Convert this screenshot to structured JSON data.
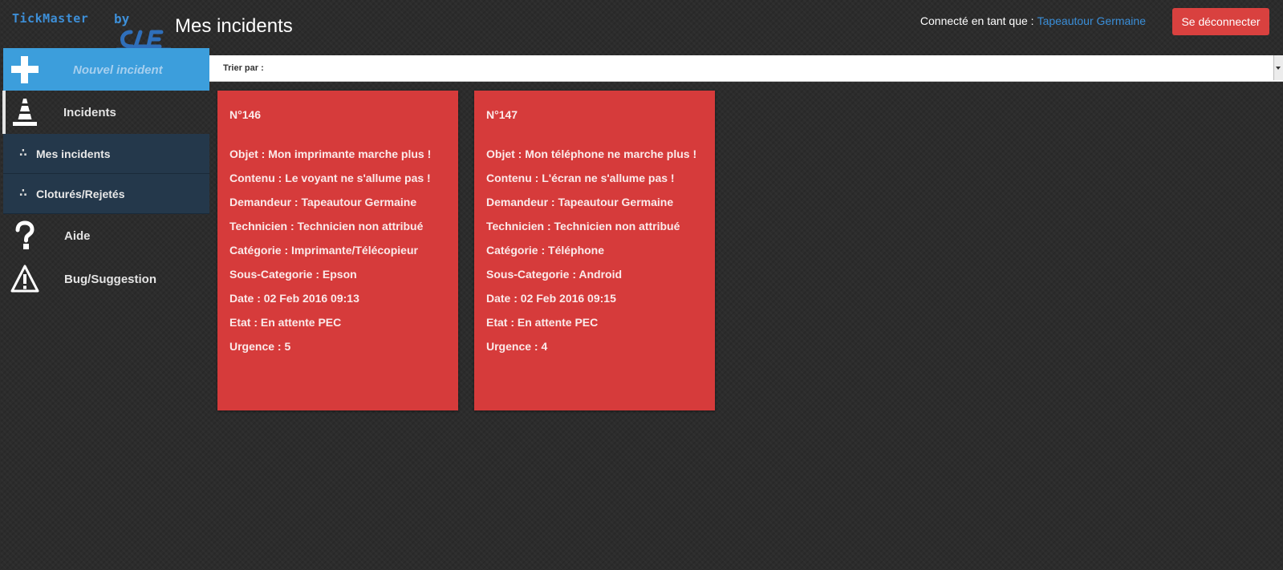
{
  "header": {
    "brand": "TickMaster",
    "by": "by",
    "page_title": "Mes incidents",
    "connected_label": "Connecté en tant que :",
    "user_name": "Tapeautour Germaine",
    "logout_label": "Se déconnecter",
    "accent_color": "#3a8ed8",
    "logout_color": "#d9413f"
  },
  "sidebar": {
    "new_incident": {
      "label": "Nouvel incident",
      "icon": "plus-icon",
      "color": "#3c9edc"
    },
    "incidents": {
      "label": "Incidents",
      "icon": "traffic-cone-icon"
    },
    "submenu": [
      {
        "label": "Mes incidents",
        "icon": "dots-icon"
      },
      {
        "label": "Cloturés/Rejetés",
        "icon": "dots-icon"
      }
    ],
    "help": {
      "label": "Aide",
      "icon": "question-mark-icon"
    },
    "bug": {
      "label": "Bug/Suggestion",
      "icon": "warning-icon"
    }
  },
  "sort": {
    "label": "Trier par :",
    "selected": ""
  },
  "incidents": [
    {
      "number": "N°146",
      "fields": [
        "Objet : Mon imprimante marche plus !",
        "Contenu : Le voyant ne s'allume pas !",
        "Demandeur : Tapeautour Germaine",
        "Technicien : Technicien non attribué",
        "Catégorie : Imprimante/Télécopieur",
        "Sous-Categorie : Epson",
        "Date : 02 Feb 2016 09:13",
        "Etat : En attente PEC",
        "Urgence : 5"
      ]
    },
    {
      "number": "N°147",
      "fields": [
        "Objet : Mon téléphone ne marche plus !",
        "Contenu : L'écran ne s'allume pas !",
        "Demandeur : Tapeautour Germaine",
        "Technicien : Technicien non attribué",
        "Catégorie : Téléphone",
        "Sous-Categorie : Android",
        "Date : 02 Feb 2016 09:15",
        "Etat : En attente PEC",
        "Urgence : 4"
      ]
    }
  ],
  "card_color": "#d63b3b"
}
